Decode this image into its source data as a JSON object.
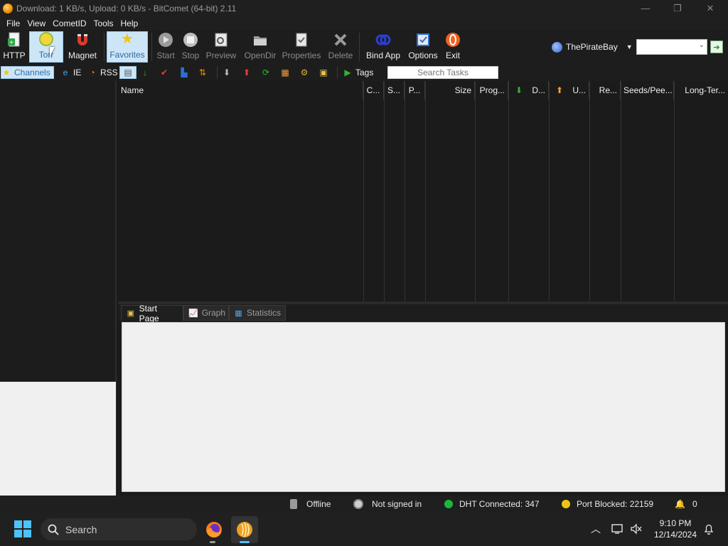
{
  "window": {
    "title": "Download: 1 KB/s, Upload: 0 KB/s - BitComet (64-bit) 2.11",
    "minimize_glyph": "—",
    "restore_glyph": "❐",
    "close_glyph": "✕"
  },
  "menu": [
    "File",
    "View",
    "CometID",
    "Tools",
    "Help"
  ],
  "toolbar": {
    "http": "HTTP",
    "torrent": "Torr",
    "magnet": "Magnet",
    "favorites": "Favorites",
    "start": "Start",
    "stop": "Stop",
    "preview": "Preview",
    "opendir": "OpenDir",
    "properties": "Properties",
    "delete": "Delete",
    "bind_app": "Bind App",
    "options": "Options",
    "exit": "Exit",
    "search_engine": "ThePirateBay",
    "search_value": ""
  },
  "secondary": {
    "channels": "Channels",
    "ie": "IE",
    "rss": "RSS",
    "tags": "Tags",
    "search_placeholder": "Search Tasks"
  },
  "columns": [
    "Name",
    "C...",
    "S...",
    "P...",
    "Size",
    "Prog...",
    "D...",
    "U...",
    "Re...",
    "Seeds/Pee...",
    "Long-Ter..."
  ],
  "tabs": [
    "Start Page",
    "Graph",
    "Statistics"
  ],
  "status": {
    "connection": "Offline",
    "account": "Not signed in",
    "dht": "DHT Connected: 347",
    "port": "Port Blocked: 22159",
    "notifications": "0"
  },
  "taskbar": {
    "search_label": "Search",
    "time": "9:10 PM",
    "date": "12/14/2024"
  },
  "colors": {
    "accent_blue": "#4cc2ff",
    "dht_green": "#19b83a",
    "port_yellow": "#f2c30f",
    "highlight": "#cde6f7"
  }
}
